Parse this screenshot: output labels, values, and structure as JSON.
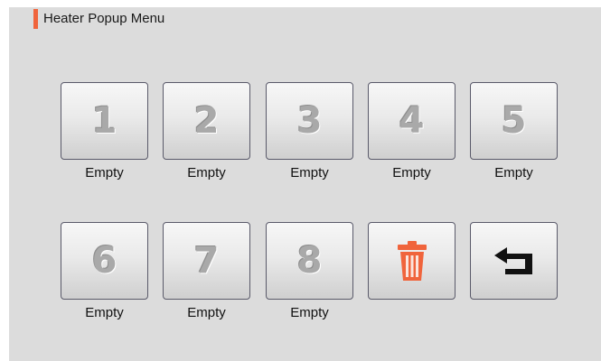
{
  "title": "Heater Popup Menu",
  "colors": {
    "accent": "#f0643c",
    "trash": "#f0643c",
    "back": "#111111",
    "panel": "#dcdcdc"
  },
  "slots": [
    {
      "number": "1",
      "label": "Empty"
    },
    {
      "number": "2",
      "label": "Empty"
    },
    {
      "number": "3",
      "label": "Empty"
    },
    {
      "number": "4",
      "label": "Empty"
    },
    {
      "number": "5",
      "label": "Empty"
    },
    {
      "number": "6",
      "label": "Empty"
    },
    {
      "number": "7",
      "label": "Empty"
    },
    {
      "number": "8",
      "label": "Empty"
    }
  ],
  "actions": {
    "delete_icon": "trash-icon",
    "back_icon": "back-arrow-icon"
  }
}
